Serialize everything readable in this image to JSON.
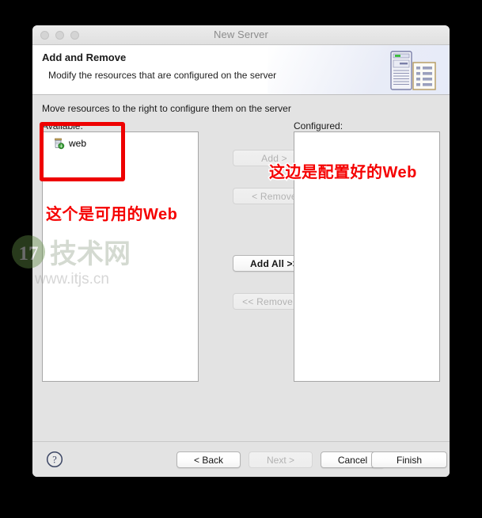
{
  "window": {
    "title": "New Server",
    "traffic_lights": [
      "close-button",
      "minimize-button",
      "maximize-button"
    ]
  },
  "banner": {
    "title": "Add and Remove",
    "subtitle": "Modify the resources that are configured on the server",
    "icon": "server-and-document-icon"
  },
  "body": {
    "hint": "Move resources to the right to configure them on the server",
    "available": {
      "label": "Available:",
      "items": [
        {
          "name": "web",
          "icon": "web-module-icon"
        }
      ]
    },
    "configured": {
      "label": "Configured:",
      "items": []
    },
    "transfer_buttons": [
      {
        "label": "Add >",
        "name": "add-button",
        "enabled": false
      },
      {
        "label": "< Remove",
        "name": "remove-button",
        "enabled": false
      },
      {
        "label": "Add All >>",
        "name": "add-all-button",
        "enabled": true
      },
      {
        "label": "<< Remove All",
        "name": "remove-all-button",
        "enabled": false
      }
    ]
  },
  "footer": {
    "help_icon": "help-question-icon",
    "buttons": [
      {
        "label": "< Back",
        "name": "back-button",
        "enabled": true
      },
      {
        "label": "Next >",
        "name": "next-button",
        "enabled": false
      },
      {
        "label": "Cancel",
        "name": "cancel-button",
        "enabled": true
      },
      {
        "label": "Finish",
        "name": "finish-button",
        "enabled": true
      }
    ]
  },
  "annotations": {
    "available_note": "这个是可用的Web",
    "configured_note": "这边是配置好的Web",
    "highlight_color": "#ee0000",
    "note_color": "#f50000"
  },
  "watermark": {
    "logo_text": "17",
    "brand": "技术网",
    "url": "www.itjs.cn"
  }
}
